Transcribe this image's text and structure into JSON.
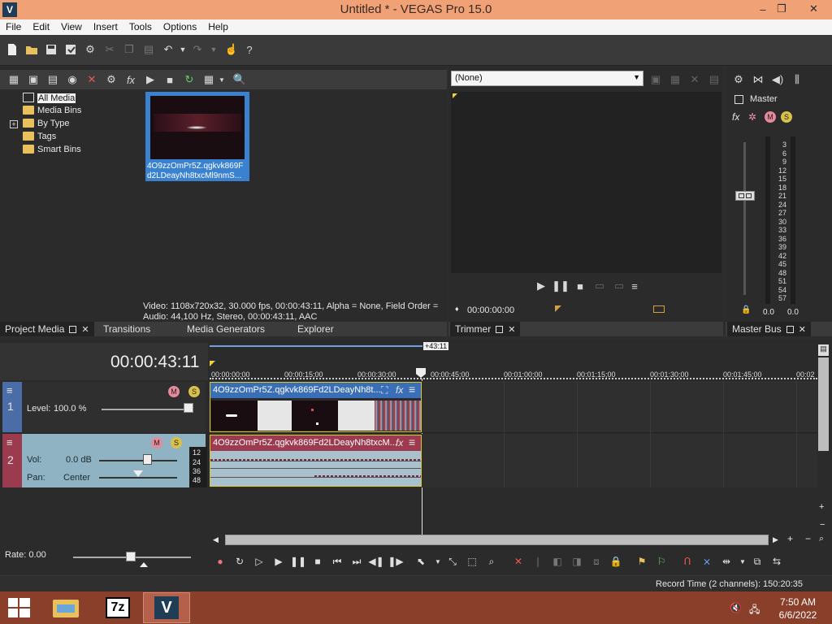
{
  "window": {
    "title": "Untitled * - VEGAS Pro 15.0",
    "logo": "V",
    "minimize": "–",
    "restore": "❐",
    "close": "✕"
  },
  "menu": [
    "File",
    "Edit",
    "View",
    "Insert",
    "Tools",
    "Options",
    "Help"
  ],
  "project_media": {
    "tree": [
      "All Media",
      "Media Bins",
      "By Type",
      "Tags",
      "Smart Bins"
    ],
    "clip_name": "4O9zzOmPr5Z.qgkvk869Fd2LDeayNh8txcMl9nmS...",
    "clip_name_line1": "4O9zzOmPr5Z.qgkvk869F",
    "clip_name_line2": "d2LDeayNh8txcMl9nmS...",
    "info_video": "Video: 1108x720x32, 30.000 fps, 00:00:43:11, Alpha = None, Field Order =",
    "info_audio": "Audio: 44,100 Hz, Stereo, 00:00:43:11, AAC"
  },
  "dock_tabs": {
    "project_media": "Project Media",
    "transitions": "Transitions",
    "media_generators": "Media Generators",
    "explorer": "Explorer",
    "trimmer": "Trimmer",
    "master_bus": "Master Bus"
  },
  "trimmer": {
    "dropdown": "(None)",
    "timecode": "00:00:00:00"
  },
  "master_bus": {
    "label": "Master",
    "scale": [
      "3",
      "6",
      "9",
      "12",
      "15",
      "18",
      "21",
      "24",
      "27",
      "30",
      "33",
      "36",
      "39",
      "42",
      "45",
      "48",
      "51",
      "54",
      "57"
    ],
    "left_value": "0.0",
    "right_value": "0.0"
  },
  "timeline": {
    "timecode": "00:00:43:11",
    "end_marker": "+43:11",
    "ruler": [
      "00:00:00;00",
      "00:00:15;00",
      "00:00:30;00",
      "00:00:45;00",
      "00:01:00;00",
      "00:01:15;00",
      "00:01:30;00",
      "00:01:45;00",
      "00:02"
    ],
    "video_track": {
      "number": "1",
      "level_label": "Level:",
      "level_value": "100.0 %"
    },
    "audio_track": {
      "number": "2",
      "vol_label": "Vol:",
      "vol_value": "0.0 dB",
      "pan_label": "Pan:",
      "pan_value": "Center",
      "db_scale": [
        "12",
        "24",
        "36",
        "48"
      ]
    },
    "clip_title": "4O9zzOmPr5Z.qgkvk869Fd2LDeayNh8t...",
    "audio_clip_title": "4O9zzOmPr5Z.qgkvk869Fd2LDeayNh8txcM...",
    "rate": "Rate: 0.00"
  },
  "status": {
    "record_time": "Record Time (2 channels): 150:20:35"
  },
  "taskbar": {
    "time": "7:50 AM",
    "date": "6/6/2022",
    "app_7z": "7z",
    "app_vegas": "V"
  },
  "colors": {
    "titlebar": "#f0a176",
    "video_track": "#4a6da8",
    "audio_track": "#9c3a4f",
    "taskbar": "#8a3f2a"
  }
}
